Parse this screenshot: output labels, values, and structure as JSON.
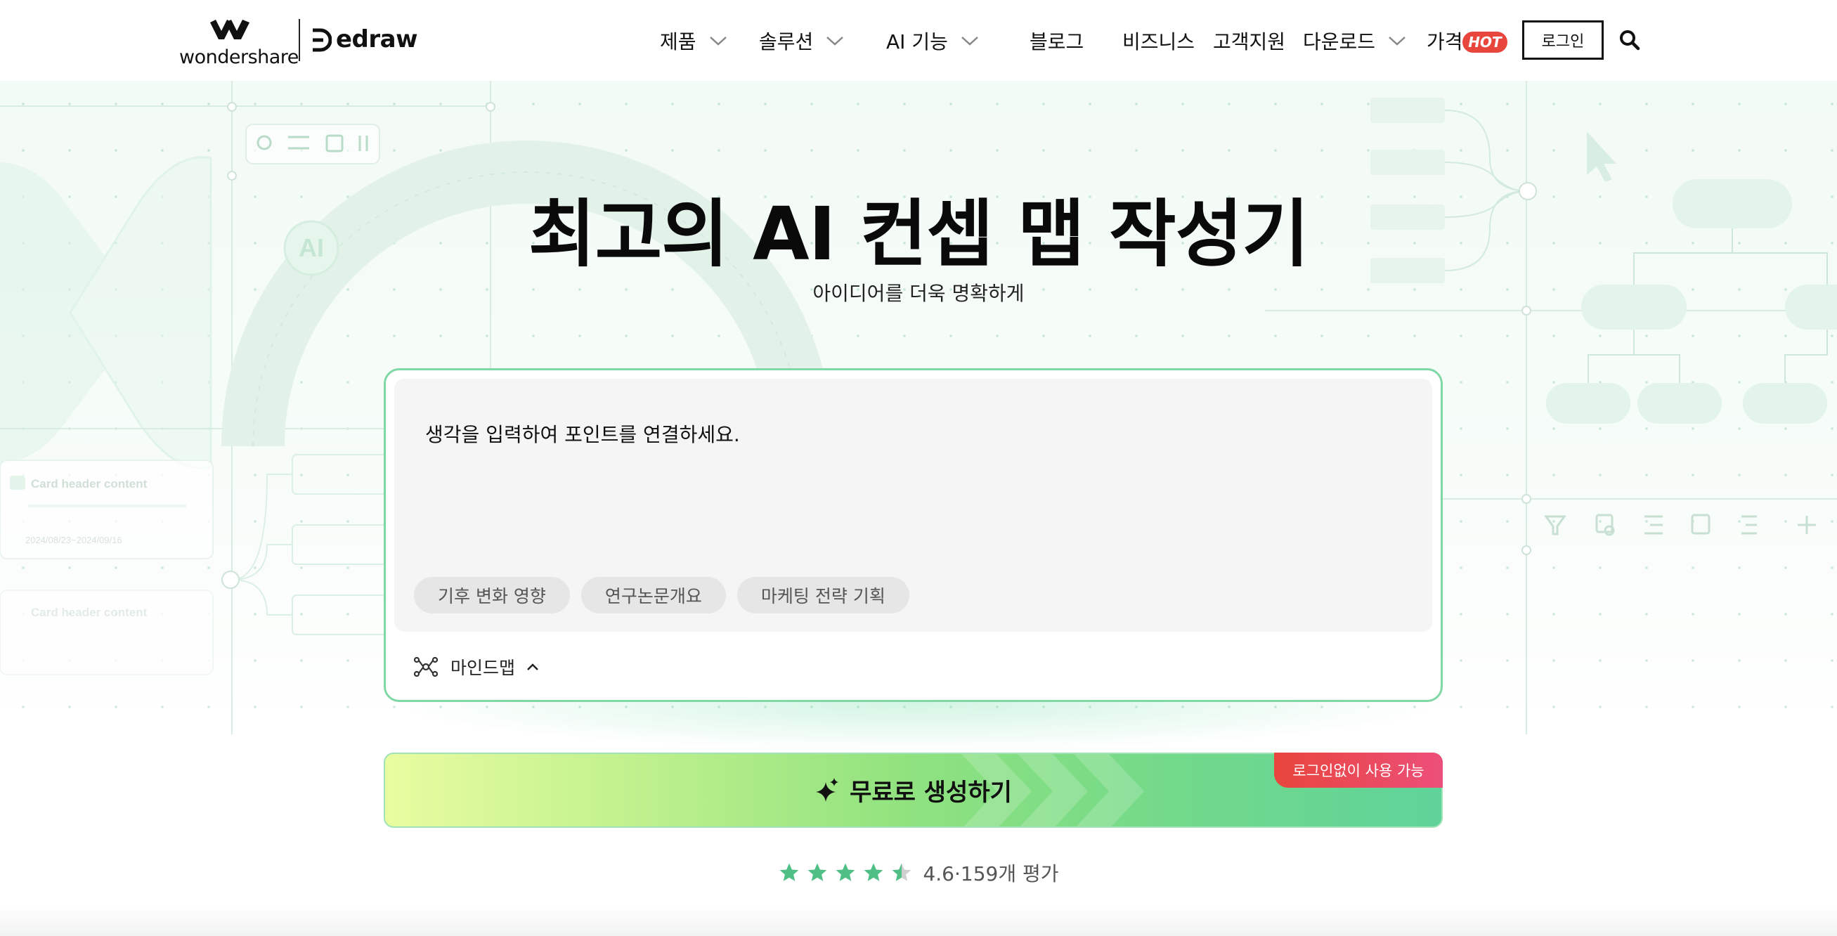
{
  "brand": {
    "company": "wondershare",
    "product": "edraw"
  },
  "nav": {
    "items": [
      {
        "label": "제품",
        "has_dropdown": true
      },
      {
        "label": "솔루션",
        "has_dropdown": true
      },
      {
        "label": "AI 기능",
        "has_dropdown": true
      },
      {
        "label": "블로그",
        "has_dropdown": false
      },
      {
        "label": "비즈니스",
        "has_dropdown": false
      },
      {
        "label": "고객지원",
        "has_dropdown": false
      },
      {
        "label": "다운로드",
        "has_dropdown": true
      },
      {
        "label": "가격",
        "has_dropdown": false
      }
    ],
    "hot_badge": "HOT",
    "login_label": "로그인",
    "search_icon": "search-icon"
  },
  "hero": {
    "title": "최고의 AI 컨셉 맵 작성기",
    "subtitle": "아이디어를 더욱 명확하게"
  },
  "prompt": {
    "text": "생각을 입력하여 포인트를 연결하세요.",
    "chips": [
      "기후 변화 영향",
      "연구논문개요",
      "마케팅 전략 기획"
    ],
    "mode_label": "마인드맵",
    "mode_icon": "mindmap-icon"
  },
  "generate": {
    "label": "무료로 생성하기",
    "icon": "sparkle-icon",
    "no_login_badge": "로그인없이 사용 가능"
  },
  "rating": {
    "score": 4.6,
    "text": "4.6·159개 평가"
  },
  "background_decoration": {
    "card_text": "Card header content",
    "card_date": "2024/08/23~2024/09/16",
    "ai_badge": "AI"
  },
  "colors": {
    "accent_green": "#5fd39a",
    "card_border": "#7fd8a6",
    "star": "#4fbf86",
    "hot": "#e8453c",
    "badge_pink": "#ec4f7a"
  }
}
